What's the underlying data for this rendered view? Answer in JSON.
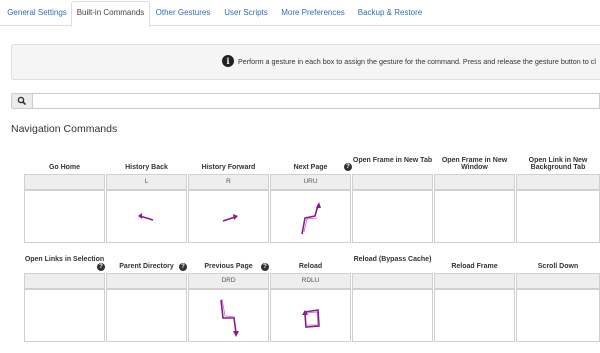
{
  "tabs": [
    {
      "label": "General Settings",
      "active": false
    },
    {
      "label": "Built-in Commands",
      "active": true
    },
    {
      "label": "Other Gestures",
      "active": false
    },
    {
      "label": "User Scripts",
      "active": false
    },
    {
      "label": "More Preferences",
      "active": false
    },
    {
      "label": "Backup & Restore",
      "active": false
    }
  ],
  "banner": {
    "icon": "info-icon",
    "text": "Perform a gesture in each box to assign the gesture for the command. Press and release the gesture button to cl"
  },
  "search": {
    "icon": "search-icon",
    "placeholder": "",
    "value": ""
  },
  "section_title": "Navigation Commands",
  "help_glyph": "?",
  "gesture_color": "#8a1d8a",
  "commands": [
    {
      "label": "Go Home",
      "gesture": "",
      "help": false
    },
    {
      "label": "History Back",
      "gesture": "L",
      "help": false
    },
    {
      "label": "History Forward",
      "gesture": "R",
      "help": false
    },
    {
      "label": "Next Page",
      "gesture": "URU",
      "help": true
    },
    {
      "label": "Open Frame in New Tab",
      "gesture": "",
      "help": false
    },
    {
      "label": "Open Frame in New Window",
      "gesture": "",
      "help": false
    },
    {
      "label": "Open Link in New Background Tab",
      "gesture": "",
      "help": false
    },
    {
      "label": "Open Links in Selection",
      "gesture": "",
      "help": true
    },
    {
      "label": "Parent Directory",
      "gesture": "",
      "help": true
    },
    {
      "label": "Previous Page",
      "gesture": "DRD",
      "help": true
    },
    {
      "label": "Reload",
      "gesture": "RDLU",
      "help": false
    },
    {
      "label": "Reload (Bypass Cache)",
      "gesture": "",
      "help": false
    },
    {
      "label": "Reload Frame",
      "gesture": "",
      "help": false
    },
    {
      "label": "Scroll Down",
      "gesture": "",
      "help": false
    }
  ]
}
